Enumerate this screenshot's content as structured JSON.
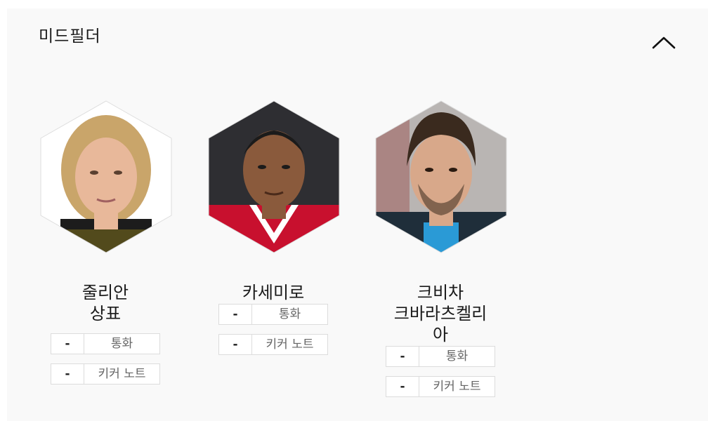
{
  "section": {
    "title": "미드필더",
    "collapse_icon": "chevron-up-icon"
  },
  "players": [
    {
      "name_lines": [
        "줄리안",
        "상표"
      ],
      "stats": [
        {
          "value": "-",
          "label": "통화"
        },
        {
          "value": "-",
          "label": "키커 노트"
        }
      ],
      "colors": {
        "jersey": "#f2d21a",
        "hair": "#c9a56a",
        "skin": "#e8b89a",
        "bg": "#ffffff"
      }
    },
    {
      "name_lines": [
        "카세미로"
      ],
      "stats": [
        {
          "value": "-",
          "label": "통화"
        },
        {
          "value": "-",
          "label": "키커 노트"
        }
      ],
      "colors": {
        "jersey": "#c8102e",
        "hair": "#1b1b1b",
        "skin": "#8a5a3c",
        "bg": "#2e2e32"
      }
    },
    {
      "name_lines": [
        "크비차",
        "크바라츠켈리",
        "아"
      ],
      "stats": [
        {
          "value": "-",
          "label": "통화"
        },
        {
          "value": "-",
          "label": "키커 노트"
        }
      ],
      "colors": {
        "jersey": "#2a9ad6",
        "hair": "#3a2a1e",
        "skin": "#d8a88a",
        "bg": "#b9b5b3"
      }
    }
  ]
}
